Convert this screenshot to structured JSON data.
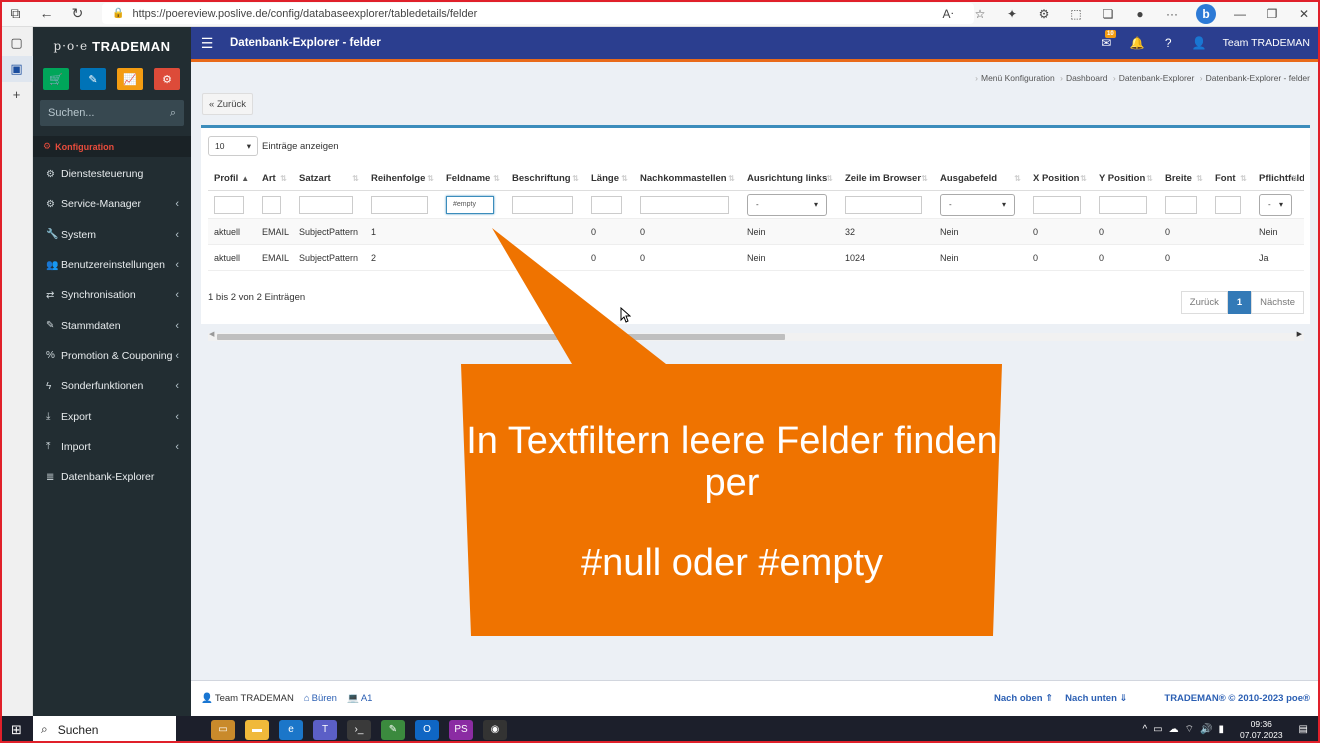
{
  "browser": {
    "url": "https://poereview.poslive.de/config/databaseexplorer/tabledetails/felder"
  },
  "sidebar": {
    "logo_poe": "p·o·e",
    "logo_text": "TRADEMAN",
    "search_placeholder": "Suchen...",
    "active_label": "Konfiguration",
    "items": [
      {
        "label": "Dienstesteuerung",
        "icon": "gear-icon"
      },
      {
        "label": "Service-Manager",
        "icon": "cogs-icon"
      },
      {
        "label": "System",
        "icon": "wrench-icon"
      },
      {
        "label": "Benutzereinstellungen",
        "icon": "users-icon"
      },
      {
        "label": "Synchronisation",
        "icon": "shuffle-icon"
      },
      {
        "label": "Stammdaten",
        "icon": "pencil-icon"
      },
      {
        "label": "Promotion & Couponing",
        "icon": "percent-icon"
      },
      {
        "label": "Sonderfunktionen",
        "icon": "bolt-icon"
      },
      {
        "label": "Export",
        "icon": "download-icon"
      },
      {
        "label": "Import",
        "icon": "upload-icon"
      },
      {
        "label": "Datenbank-Explorer",
        "icon": "database-icon"
      }
    ],
    "quick_colors": [
      "#00a65a",
      "#0073b7",
      "#f39c12",
      "#dd4b39"
    ]
  },
  "navbar": {
    "title": "Datenbank-Explorer - felder",
    "badge": "10",
    "user": "Team TRADEMAN"
  },
  "breadcrumb": [
    "Menü Konfiguration",
    "Dashboard",
    "Datenbank-Explorer",
    "Datenbank-Explorer - felder"
  ],
  "back_label": "« Zurück",
  "table": {
    "length_value": "10",
    "length_label": "Einträge anzeigen",
    "columns": [
      {
        "label": "Profil",
        "w": 0,
        "filter": "text"
      },
      {
        "label": "Art",
        "filter": "text"
      },
      {
        "label": "Satzart",
        "filter": "text"
      },
      {
        "label": "Reihenfolge",
        "filter": "text"
      },
      {
        "label": "Feldname",
        "filter": "text"
      },
      {
        "label": "Beschriftung",
        "filter": "text"
      },
      {
        "label": "Länge",
        "filter": "text"
      },
      {
        "label": "Nachkommastellen",
        "filter": "text"
      },
      {
        "label": "Ausrichtung links",
        "filter": "select"
      },
      {
        "label": "Zeile im Browser",
        "filter": "text"
      },
      {
        "label": "Ausgabefeld",
        "filter": "select"
      },
      {
        "label": "X Position",
        "filter": "text"
      },
      {
        "label": "Y Position",
        "filter": "text"
      },
      {
        "label": "Breite",
        "filter": "text"
      },
      {
        "label": "Font",
        "filter": "text"
      },
      {
        "label": "Pflichtfeld",
        "filter": "select"
      }
    ],
    "feldname_filter_value": "#empty",
    "select_placeholder": "-",
    "rows": [
      [
        "aktuell",
        "EMAIL",
        "SubjectPattern",
        "1",
        "",
        "",
        "0",
        "0",
        "Nein",
        "32",
        "Nein",
        "0",
        "0",
        "0",
        "",
        "Nein"
      ],
      [
        "aktuell",
        "EMAIL",
        "SubjectPattern",
        "2",
        "",
        "",
        "0",
        "0",
        "Nein",
        "1024",
        "Nein",
        "0",
        "0",
        "0",
        "",
        "Ja"
      ]
    ],
    "info": "1 bis 2 von 2 Einträgen",
    "pager": {
      "prev": "Zurück",
      "current": "1",
      "next": "Nächste"
    }
  },
  "footer": {
    "user": "Team TRADEMAN",
    "location": "Büren",
    "terminal": "A1",
    "nach_oben": "Nach oben",
    "nach_unten": "Nach unten",
    "copyright_brand": "TRADEMAN",
    "copyright": "© 2010-2023 poe"
  },
  "callout": {
    "line1": "In Textfiltern leere Felder finden per",
    "line2": "#null oder #empty",
    "color": "#ef7300"
  },
  "taskbar": {
    "search": "Suchen",
    "time": "09:36",
    "date": "07.07.2023"
  }
}
